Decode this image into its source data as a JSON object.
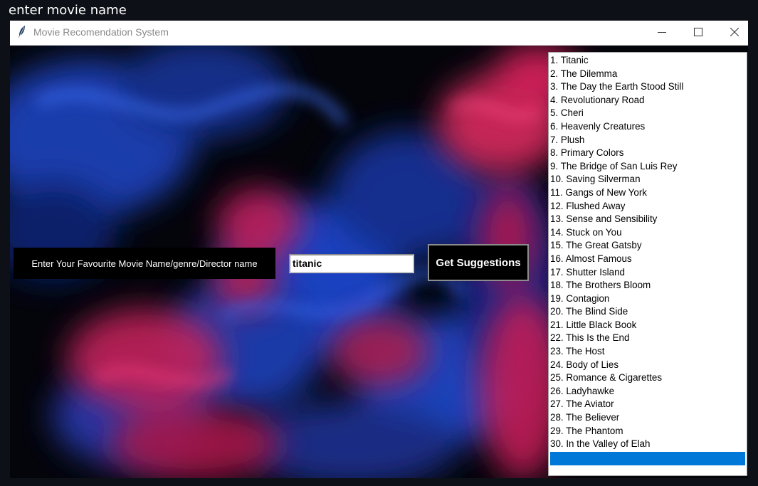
{
  "console": {
    "text": "enter movie name"
  },
  "window": {
    "title": "Movie Recomendation System",
    "app_icon": "feather-icon"
  },
  "form": {
    "prompt_label": "Enter Your Favourite Movie Name/genre/Director name",
    "search_value": "titanic",
    "button_label": "Get Suggestions"
  },
  "results": [
    "1. Titanic",
    "2. The Dilemma",
    "3. The Day the Earth Stood Still",
    "4. Revolutionary Road",
    "5. Cheri",
    "6. Heavenly Creatures",
    "7. Plush",
    "8. Primary Colors",
    "9. The Bridge of San Luis Rey",
    "10. Saving Silverman",
    "11. Gangs of New York",
    "12. Flushed Away",
    "13. Sense and Sensibility",
    "14. Stuck on You",
    "15. The Great Gatsby",
    "16. Almost Famous",
    "17. Shutter Island",
    "18. The Brothers Bloom",
    "19. Contagion",
    "20. The Blind Side",
    "21. Little Black Book",
    "22. This Is the End",
    "23. The Host",
    "24. Body of Lies",
    "25. Romance & Cigarettes",
    "26. Ladyhawke",
    "27. The Aviator",
    "28. The Believer",
    "29. The Phantom",
    "30. In the Valley of Elah"
  ],
  "colors": {
    "selection": "#0078d7",
    "smoke_blue": "#1f4fd6",
    "smoke_pink": "#e0215e"
  }
}
